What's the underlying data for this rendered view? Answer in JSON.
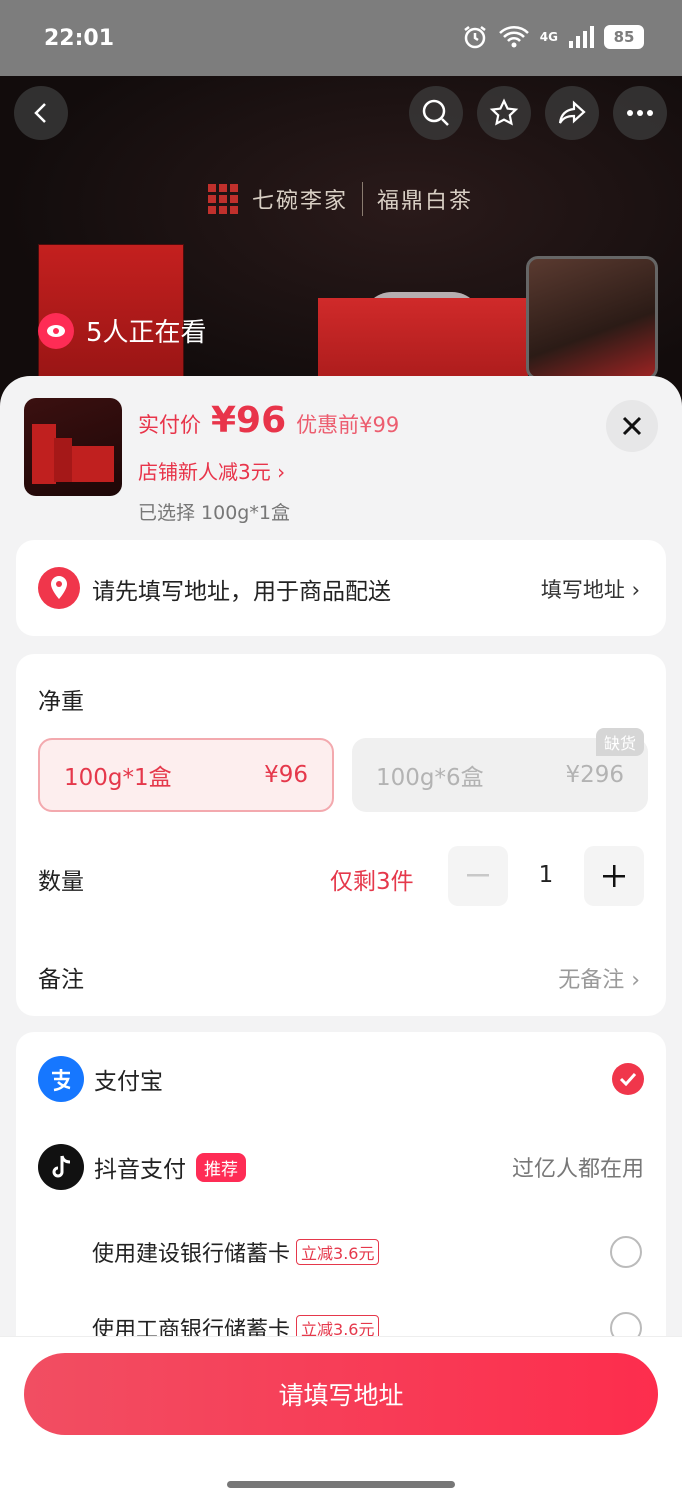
{
  "status_bar": {
    "time": "22:01",
    "network": "4G",
    "battery": "85"
  },
  "hero": {
    "brand_left": "七碗李家",
    "brand_right": "福鼎白茶",
    "watching_text": "5人正在看"
  },
  "product": {
    "price_label": "实付价",
    "price_value": "¥96",
    "price_before": "优惠前¥99",
    "discount": "店铺新人减3元 ›",
    "selected": "已选择 100g*1盒"
  },
  "address": {
    "prompt": "请先填写地址，用于商品配送",
    "action": "填写地址 ›"
  },
  "spec": {
    "weight_title": "净重",
    "options": [
      {
        "name": "100g*1盒",
        "price": "¥96"
      },
      {
        "name": "100g*6盒",
        "price": "¥296",
        "tag": "缺货"
      }
    ],
    "quantity_title": "数量",
    "stock_text": "仅剩3件",
    "quantity": "1",
    "note_title": "备注",
    "note_value": "无备注 ›"
  },
  "payment": {
    "alipay": "支付宝",
    "douyin": "抖音支付",
    "douyin_badge": "推荐",
    "douyin_note": "过亿人都在用",
    "banks": [
      {
        "label": "使用建设银行储蓄卡",
        "tag": "立减3.6元"
      },
      {
        "label": "使用工商银行储蓄卡",
        "tag": "立减3.6元"
      }
    ]
  },
  "submit_label": "请填写地址",
  "colors": {
    "accent": "#fe2c55",
    "price": "#e8344a"
  }
}
